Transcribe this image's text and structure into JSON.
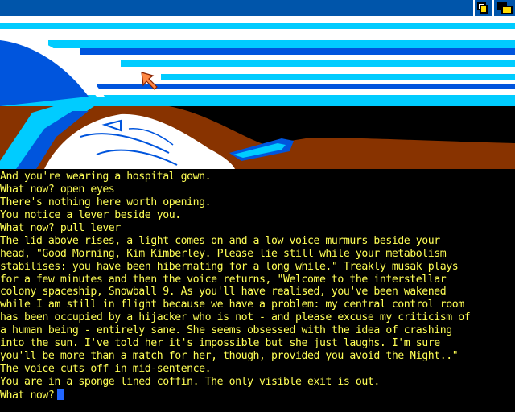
{
  "window": {
    "back_gadget_icon": "depth-back-icon",
    "front_gadget_icon": "depth-front-icon"
  },
  "scene": {
    "description_icon": "hibernation-coffin-scene",
    "pointer_icon": "arrow-pointer-icon",
    "colors": {
      "sky_white": "#ffffff",
      "cyan": "#00ccff",
      "blue": "#0055dd",
      "brown": "#883300",
      "background": "#000000"
    }
  },
  "transcript": {
    "lines": [
      "And you're wearing a hospital gown.",
      "What now? open eyes",
      "There's nothing here worth opening.",
      "You notice a lever beside you.",
      "What now? pull lever",
      "The lid above rises, a light comes on and a low voice murmurs beside your",
      "head, \"Good Morning, Kim Kimberley. Please lie still while your metabolism",
      "stabilises: you have been hibernating for a long while.\" Treakly musak plays",
      "for a few minutes and then the voice returns, \"Welcome to the interstellar",
      "colony spaceship, Snowball 9. As you'll have realised, you've been wakened",
      "while I am still in flight because we have a problem: my central control room",
      "has been occupied by a hijacker who is not - and please excuse my criticism of",
      "a human being - entirely sane. She seems obsessed with the idea of crashing",
      "into the sun. I've told her it's impossible but she just laughs. I'm sure",
      "you'll be more than a match for her, though, provided you avoid the Night..\"",
      "The voice cuts off in mid-sentence.",
      "You are in a sponge lined coffin. The only visible exit is out."
    ],
    "prompt": "What now?",
    "input_value": ""
  },
  "colors": {
    "title_bar": "#0055aa",
    "text": "#ffff55",
    "cursor": "#2266ff"
  }
}
